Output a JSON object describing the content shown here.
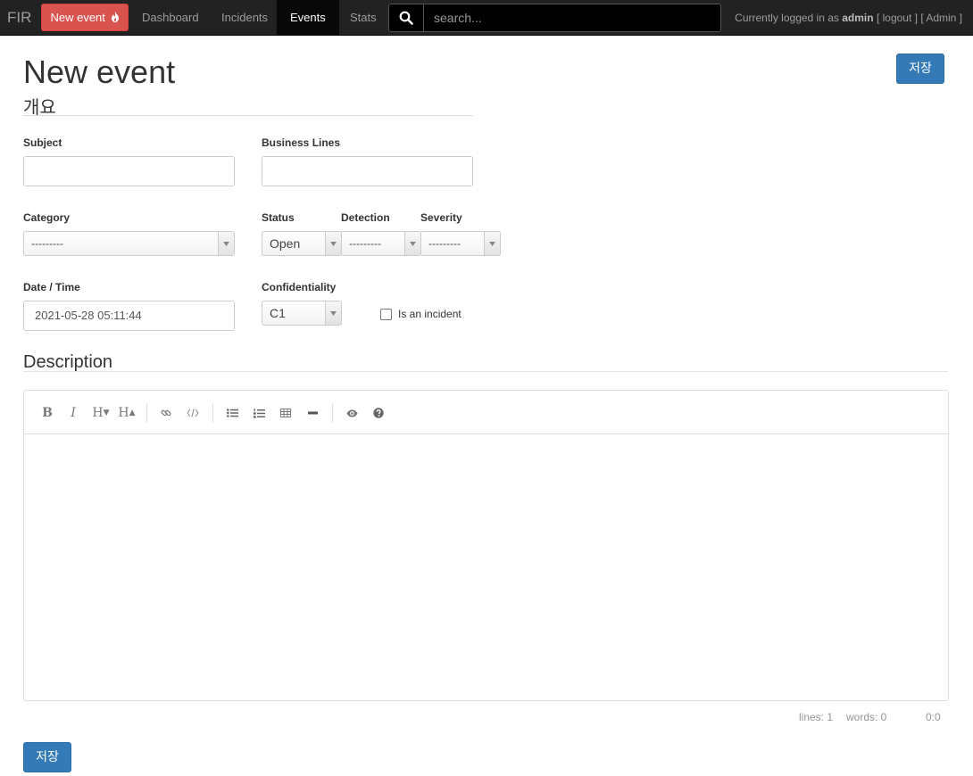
{
  "nav": {
    "brand": "FIR",
    "new_event": "New event",
    "links": [
      "Dashboard",
      "Incidents",
      "Events",
      "Stats"
    ],
    "search_placeholder": "search...",
    "user_prefix": "Currently logged in as",
    "username": "admin",
    "logout": "[ logout ]",
    "admin": "[ Admin ]"
  },
  "page": {
    "title": "New event",
    "subtitle": "개요",
    "save_label": "저장"
  },
  "form": {
    "subject_label": "Subject",
    "subject_value": "",
    "business_lines_label": "Business Lines",
    "business_lines_value": "",
    "category_label": "Category",
    "category_value": "---------",
    "status_label": "Status",
    "status_value": "Open",
    "detection_label": "Detection",
    "detection_value": "---------",
    "severity_label": "Severity",
    "severity_value": "---------",
    "datetime_label": "Date / Time",
    "datetime_value": "2021-05-28 05:11:44",
    "confidentiality_label": "Confidentiality",
    "confidentiality_value": "C1",
    "is_incident_label": "Is an incident",
    "is_incident_checked": false
  },
  "description": {
    "title": "Description",
    "toolbar": [
      "bold-icon",
      "italic-icon",
      "heading-smaller-icon",
      "heading-bigger-icon",
      "link-icon",
      "code-icon",
      "unordered-list-icon",
      "ordered-list-icon",
      "table-icon",
      "horizontal-rule-icon",
      "preview-icon",
      "help-icon"
    ],
    "lines": "lines: 1",
    "words": "words: 0",
    "cursor": "0:0"
  },
  "colors": {
    "navbar": "#222222",
    "new_event": "#d9534f",
    "primary": "#337ab7"
  }
}
